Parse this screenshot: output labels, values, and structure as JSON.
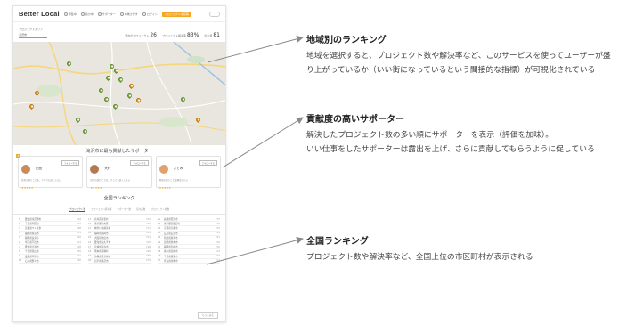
{
  "screenshot": {
    "logo": "Better Local",
    "nav": [
      "募集中",
      "協力中",
      "サポーター",
      "地域さがす",
      "ログイン"
    ],
    "cta": "プロジェクトを投稿",
    "stat_region_label": "プロジェクトエリア",
    "stat_region_value": "滝沢市",
    "stat_projects_label": "現在のプロジェクト",
    "stat_projects_value": "26",
    "stat_rate_label": "プロジェクト解決率",
    "stat_rate_value": "83%",
    "stat_supporters_label": "協力者",
    "stat_supporters_value": "81",
    "supporters_title": "滝沢市に最も貢献したサポーター",
    "supporters": [
      {
        "name": "田島",
        "button": "フォローする",
        "text": "日常の困りごとを、少しでも良くしたい",
        "stars": "★★★★★",
        "rank": "1"
      },
      {
        "name": "大村",
        "button": "フォローする",
        "text": "日常の困りごとを、少しでも良くしたい",
        "stars": "★★★★★",
        "rank": ""
      },
      {
        "name": "さとみ",
        "button": "フォローする",
        "text": "地域の困りごとを解決したい",
        "stars": "★★★★★",
        "rank": ""
      }
    ],
    "ranking_title": "全国ランキング",
    "tabs": [
      "プロジェクト数",
      "プロジェクト解決率",
      "サポーター数",
      "協力者数",
      "プロジェクト総数"
    ],
    "ranking": [
      [
        {
          "n": "1",
          "c": "愛知県滝沢郡市",
          "v": "564"
        },
        {
          "n": "2",
          "c": "千葉県印西市",
          "v": "512"
        },
        {
          "n": "3",
          "c": "茨城県つくば市",
          "v": "488"
        },
        {
          "n": "4",
          "c": "福岡県糸島市",
          "v": "451"
        },
        {
          "n": "5",
          "c": "静岡県長泉町",
          "v": "430"
        },
        {
          "n": "6",
          "c": "埼玉県戸田市",
          "v": "412"
        },
        {
          "n": "7",
          "c": "愛知県日進市",
          "v": "398"
        },
        {
          "n": "8",
          "c": "千葉県流山市",
          "v": "385"
        },
        {
          "n": "9",
          "c": "滋賀県草津市",
          "v": "371"
        },
        {
          "n": "10",
          "c": "石川県野々市",
          "v": "360"
        }
      ],
      [
        {
          "n": "11",
          "c": "北海道音更町",
          "v": "352"
        },
        {
          "n": "12",
          "c": "東京都中央区",
          "v": "340"
        },
        {
          "n": "13",
          "c": "神奈川県横浜市",
          "v": "331"
        },
        {
          "n": "14",
          "c": "福岡県福岡市",
          "v": "322"
        },
        {
          "n": "15",
          "c": "大阪府吹田市",
          "v": "314"
        },
        {
          "n": "16",
          "c": "愛知県長久手市",
          "v": "305"
        },
        {
          "n": "17",
          "c": "宮城県富谷市",
          "v": "298"
        },
        {
          "n": "18",
          "c": "熊本県菊陽町",
          "v": "290"
        },
        {
          "n": "19",
          "c": "沖縄県豊見城市",
          "v": "283"
        },
        {
          "n": "20",
          "c": "岩手県滝沢市",
          "v": "276"
        }
      ],
      [
        {
          "n": "21",
          "c": "兵庫県西宮市",
          "v": "270"
        },
        {
          "n": "22",
          "c": "東京都武蔵野市",
          "v": "262"
        },
        {
          "n": "23",
          "c": "京都府京都市",
          "v": "255"
        },
        {
          "n": "24",
          "c": "広島県広島市",
          "v": "249"
        },
        {
          "n": "25",
          "c": "新潟県新潟市",
          "v": "241"
        },
        {
          "n": "26",
          "c": "長野県松本市",
          "v": "236"
        },
        {
          "n": "27",
          "c": "静岡県浜松市",
          "v": "230"
        },
        {
          "n": "28",
          "c": "香川県高松市",
          "v": "224"
        },
        {
          "n": "29",
          "c": "千葉県浦安市",
          "v": "218"
        },
        {
          "n": "30",
          "c": "奈良県生駒市",
          "v": "212"
        }
      ]
    ],
    "more": "もっとみる"
  },
  "annotations": [
    {
      "title": "地域別のランキング",
      "body": "地域を選択すると、プロジェクト数や解決率など、このサービスを使ってユーザーが盛り上がっているか（いい街になっているという間接的な指標）が可視化されている"
    },
    {
      "title": "貢献度の高いサポーター",
      "body": "解決したプロジェクト数の多い順にサポーターを表示（評価を加味）。",
      "body2": "いい仕事をしたサポーターは露出を上げ、さらに貢献してもらうように促している"
    },
    {
      "title": "全国ランキング",
      "body": "プロジェクト数や解決率など、全国上位の市区町村が表示される"
    }
  ],
  "colors": {
    "accent": "#f5a623",
    "pin_green": "#7cb342",
    "pin_orange": "#f39c12",
    "arrow": "#8a8a8a"
  }
}
